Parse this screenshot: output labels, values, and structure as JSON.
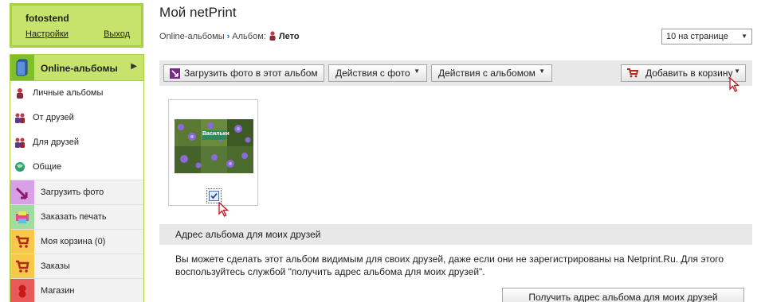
{
  "user": {
    "name": "fotostend",
    "settings_label": "Настройки",
    "logout_label": "Выход"
  },
  "sidebar": {
    "top_item": {
      "label": "Online-альбомы",
      "icon": "albums-icon"
    },
    "sub_items": [
      {
        "label": "Личные альбомы",
        "icon": "person-icon"
      },
      {
        "label": "От друзей",
        "icon": "friends-icon"
      },
      {
        "label": "Для друзей",
        "icon": "friends-icon"
      },
      {
        "label": "Общие",
        "icon": "globe-icon"
      }
    ],
    "action_items": [
      {
        "label": "Загрузить фото",
        "icon": "upload-icon"
      },
      {
        "label": "Заказать печать",
        "icon": "print-icon"
      },
      {
        "label": "Моя корзина (0)",
        "icon": "cart-icon"
      },
      {
        "label": "Заказы",
        "icon": "orders-icon"
      },
      {
        "label": "Магазин",
        "icon": "shop-icon"
      }
    ]
  },
  "header": {
    "title": "Мой netPrint",
    "breadcrumb": {
      "root": "Online-альбомы",
      "album_prefix": "Альбом:",
      "current": "Лето"
    },
    "per_page": "10 на странице"
  },
  "toolbar": {
    "upload": "Загрузить фото в этот альбом",
    "photo_actions": "Действия с фото",
    "album_actions": "Действия с альбомом",
    "add_to_cart": "Добавить в корзину"
  },
  "photo": {
    "caption": "Васильки",
    "checked": true
  },
  "share": {
    "heading": "Адрес альбома для моих друзей",
    "description": "Вы можете сделать этот альбом видимым для своих друзей, даже если они не зарегистрированы на Netprint.Ru. Для этого воспользуйтесь службой \"получить адрес альбома для моих друзей\".",
    "button": "Получить адрес альбома для моих друзей"
  },
  "colors": {
    "accent_green": "#c6e36b",
    "border_green": "#a8cf43",
    "toolbar_gray": "#e8e8e8"
  }
}
